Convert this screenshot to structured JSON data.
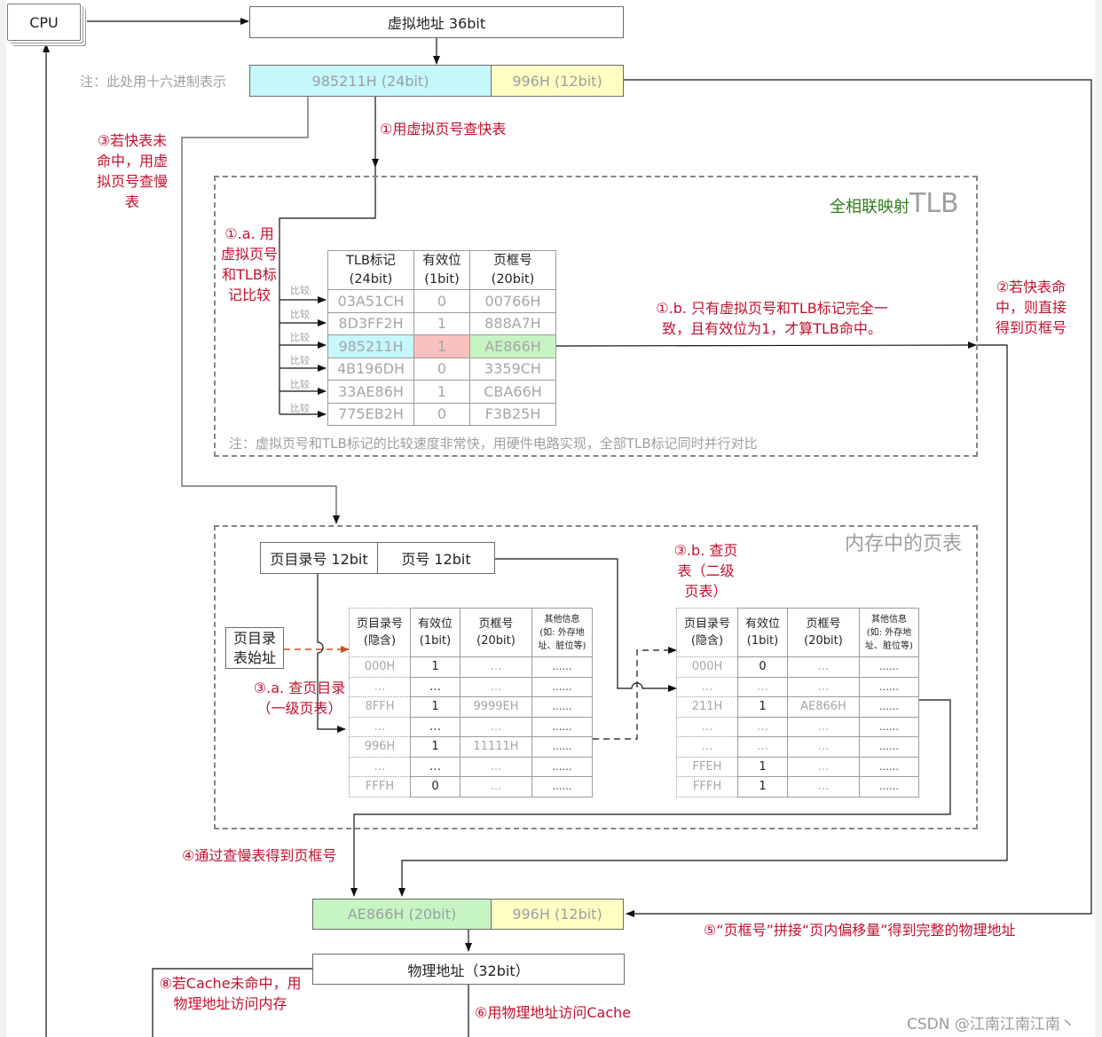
{
  "cpu": {
    "label": "CPU"
  },
  "virtual_address": {
    "label": "虚拟地址 36bit"
  },
  "hex_note": "注：此处用十六进制表示",
  "va_split": {
    "page_number": "985211H (24bit)",
    "offset": "996H (12bit)"
  },
  "steps": {
    "s1": "①用虚拟页号查快表",
    "s1a": [
      "①.a. 用",
      "虚拟页号",
      "和TLB标",
      "记比较"
    ],
    "s1b": [
      "①.b. 只有虚拟页号和TLB标记完全一",
      "致，且有效位为1，才算TLB命中。"
    ],
    "s2": [
      "②若快表命",
      "中，则直接",
      "得到页框号"
    ],
    "s3": [
      "③若快表未",
      "命中，用虚",
      "拟页号查慢",
      "表"
    ],
    "s3a": [
      "③.a. 查页目录",
      "（一级页表）"
    ],
    "s3b": [
      "③.b. 查页",
      "表（二级",
      "页表）"
    ],
    "s4": "④通过查慢表得到页框号",
    "s5": "⑤“页框号”拼接“页内偏移量”得到完整的物理地址",
    "s6": "⑥用物理地址访问Cache",
    "s8": [
      "⑧若Cache未命中，用",
      "物理地址访问内存"
    ]
  },
  "tlb": {
    "title_green": "全相联映射",
    "title_gray": "TLB",
    "compare_label": "比较",
    "headers": [
      [
        "TLB标记",
        "(24bit)"
      ],
      [
        "有效位",
        "(1bit)"
      ],
      [
        "页框号",
        "(20bit)"
      ]
    ],
    "rows": [
      [
        "03A51CH",
        "0",
        "00766H"
      ],
      [
        "8D3FF2H",
        "1",
        "888A7H"
      ],
      [
        "985211H",
        "1",
        "AE866H"
      ],
      [
        "4B196DH",
        "0",
        "3359CH"
      ],
      [
        "33AE86H",
        "1",
        "CBA66H"
      ],
      [
        "775EB2H",
        "0",
        "F3B25H"
      ]
    ],
    "hit_row_index": 2,
    "note": "注：虚拟页号和TLB标记的比较速度非常快，用硬件电路实现，全部TLB标记同时并行对比"
  },
  "memory_page_table": {
    "title": "内存中的页表",
    "vpn_split": {
      "dir": "页目录号 12bit",
      "page": "页号 12bit"
    },
    "dir_base": [
      "页目录",
      "表始址"
    ],
    "headers": [
      [
        "页目录号",
        "(隐含)"
      ],
      [
        "有效位",
        "(1bit)"
      ],
      [
        "页框号",
        "(20bit)"
      ],
      [
        "其他信息",
        "(如: 外存地",
        "址、脏位等)"
      ]
    ],
    "level1_rows": [
      [
        "000H",
        "1",
        "…",
        "……"
      ],
      [
        "…",
        "…",
        "…",
        "……"
      ],
      [
        "8FFH",
        "1",
        "9999EH",
        "……"
      ],
      [
        "…",
        "…",
        "…",
        "……"
      ],
      [
        "996H",
        "1",
        "11111H",
        "……"
      ],
      [
        "…",
        "…",
        "…",
        "……"
      ],
      [
        "FFFH",
        "0",
        "…",
        "……"
      ]
    ],
    "level2_rows": [
      [
        "000H",
        "0",
        "…",
        "……"
      ],
      [
        "…",
        "…",
        "…",
        "……"
      ],
      [
        "211H",
        "1",
        "AE866H",
        "……"
      ],
      [
        "…",
        "…",
        "…",
        "……"
      ],
      [
        "…",
        "…",
        "…",
        "……"
      ],
      [
        "FFEH",
        "1",
        "…",
        "……"
      ],
      [
        "FFFH",
        "1",
        "…",
        "……"
      ]
    ]
  },
  "pa_split": {
    "frame": "AE866H (20bit)",
    "offset": "996H (12bit)"
  },
  "physical_address": {
    "label": "物理地址（32bit）"
  },
  "watermark": "CSDN @江南江南江南丶",
  "colors": {
    "step_red": "#c3102e",
    "tlb_green": "#2e7d18",
    "cyan": "#c5f7fb",
    "yellow": "#ffffc4",
    "green": "#c6f5c3",
    "pink": "#f9c0c0",
    "orange_arrow": "#c2541a"
  }
}
